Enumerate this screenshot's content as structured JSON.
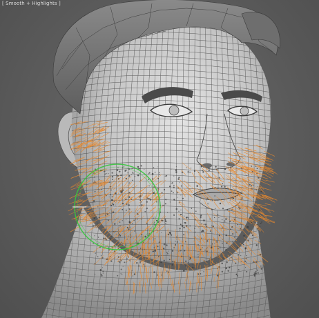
{
  "viewport": {
    "label": "[ Smooth + Highlights ]",
    "shading_mode": "smooth-highlights"
  },
  "scene": {
    "model": "male-head-wireframe",
    "mesh_color": "#c9c9c9",
    "wire_color": "#3f3f3f",
    "hair_guide_color": "#e8892e",
    "brush_gizmo_color": "#39c43f",
    "background_color": "#5c5c5c"
  }
}
